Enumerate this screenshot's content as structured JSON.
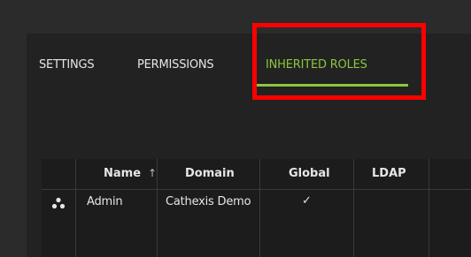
{
  "tabs": [
    {
      "label": "SETTINGS",
      "active": false
    },
    {
      "label": "PERMISSIONS",
      "active": false
    },
    {
      "label": "INHERITED ROLES",
      "active": true
    }
  ],
  "colors": {
    "accent": "#8cc63f",
    "highlight": "#ff0000"
  },
  "table": {
    "columns": [
      "Name",
      "Domain",
      "Global",
      "LDAP"
    ],
    "sort": {
      "column": "Name",
      "direction": "ascending",
      "icon": "arrow-up-icon"
    },
    "rows": [
      {
        "icon": "role-group-icon",
        "name": "Admin",
        "domain": "Cathexis Demo",
        "global": "✓",
        "ldap": ""
      }
    ]
  }
}
